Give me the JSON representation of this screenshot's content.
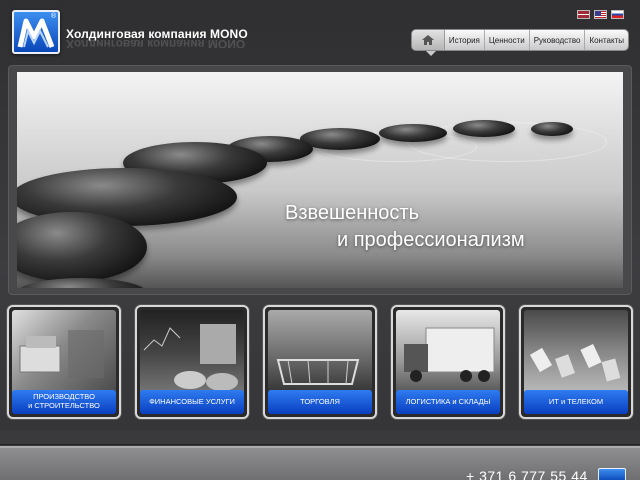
{
  "header": {
    "company_name": "Холдинговая компания MONO",
    "logo_mark": "®"
  },
  "languages": [
    {
      "code": "lv",
      "icon": "latvia-flag-icon"
    },
    {
      "code": "en",
      "icon": "usa-flag-icon"
    },
    {
      "code": "ru",
      "icon": "russia-flag-icon"
    }
  ],
  "nav": {
    "home_icon": "home-icon",
    "items": [
      "История",
      "Ценности",
      "Руководство",
      "Контакты"
    ]
  },
  "banner": {
    "line1": "Взвешенность",
    "line2": "и профессионализм"
  },
  "categories": [
    {
      "label": "ПРОИЗВОДСТВО\nи СТРОИТЕЛЬСТВО"
    },
    {
      "label": "ФИНАНСОВЫЕ УСЛУГИ"
    },
    {
      "label": "ТОРГОВЛЯ"
    },
    {
      "label": "ЛОГИСТИКА и СКЛАДЫ"
    },
    {
      "label": "ИТ и ТЕЛЕКОМ"
    }
  ],
  "footer": {
    "phone": "+ 371 6 777 55 44"
  },
  "colors": {
    "accent_blue": "#1a5fd8",
    "background": "#3a3a3c"
  }
}
